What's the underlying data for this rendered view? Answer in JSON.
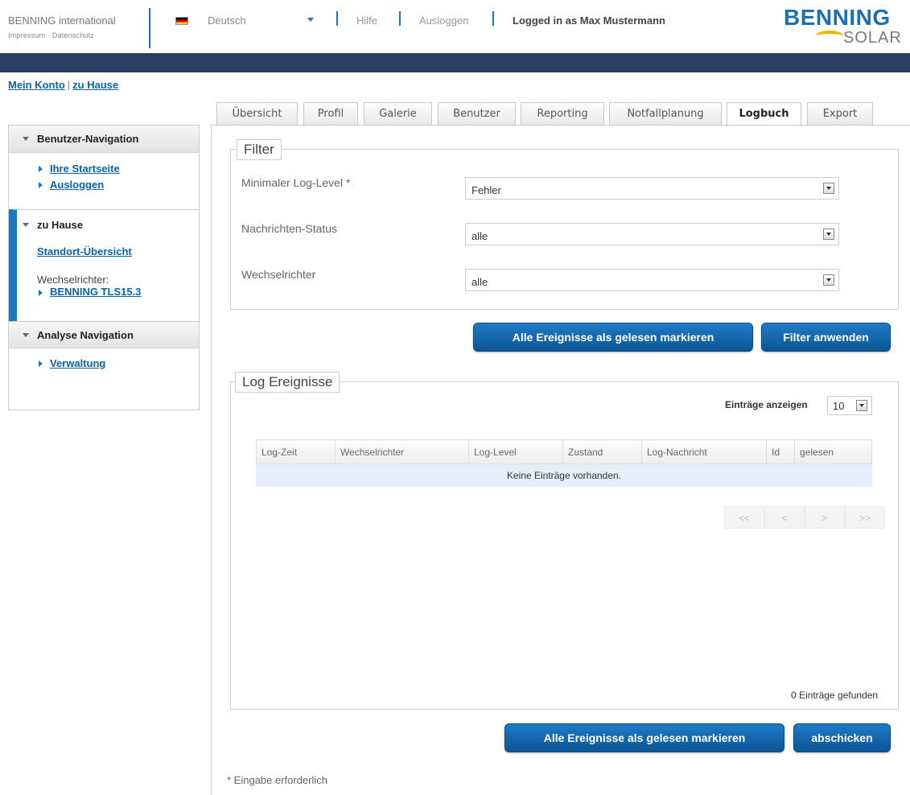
{
  "header": {
    "brand": "BENNING international",
    "brand_links": "Impressum · Datenschutz",
    "language": "Deutsch",
    "help": "Hilfe",
    "logout": "Ausloggen",
    "logged_in": "Logged in as Max Mustermann",
    "logo_line1": "BENNING",
    "logo_line2": "SOLAR"
  },
  "breadcrumb": {
    "item1": "Mein Konto",
    "sep": "|",
    "item2": "zu Hause"
  },
  "tabs": [
    "Übersicht",
    "Profil",
    "Galerie",
    "Benutzer",
    "Reporting",
    "Notfallplanung",
    "Logbuch",
    "Export"
  ],
  "sidebar": {
    "section1": {
      "title": "Benutzer-Navigation",
      "items": [
        "Ihre Startseite",
        "Ausloggen"
      ]
    },
    "section2": {
      "title": "zu Hause",
      "overview": "Standort-Übersicht",
      "inverter_label": "Wechselrichter:",
      "inverter": "BENNING TLS15.3"
    },
    "section3": {
      "title": "Analyse Navigation",
      "items": [
        "Verwaltung"
      ]
    }
  },
  "filter": {
    "legend": "Filter",
    "fields": [
      {
        "label": "Minimaler Log-Level *",
        "value": "Fehler"
      },
      {
        "label": "Nachrichten-Status",
        "value": "alle"
      },
      {
        "label": "Wechselrichter",
        "value": "alle"
      }
    ],
    "mark_read_button": "Alle Ereignisse als gelesen markieren",
    "apply_button": "Filter anwenden"
  },
  "log": {
    "legend": "Log Ereignisse",
    "entries_label": "Einträge anzeigen",
    "entries_value": "10",
    "columns": [
      "Log-Zeit",
      "Wechselrichter",
      "Log-Level",
      "Zustand",
      "Log-Nachricht",
      "Id",
      "gelesen"
    ],
    "empty_text": "Keine Einträge vorhanden.",
    "pager": [
      "<<",
      "<",
      ">",
      ">>"
    ],
    "found": "0 Einträge gefunden"
  },
  "bottom": {
    "mark_read_button": "Alle Ereignisse als gelesen markieren",
    "submit_button": "abschicken",
    "required_note": "* Eingabe erforderlich"
  },
  "colors": {
    "accent": "#1a78c2",
    "topbar": "#2a3e61",
    "button": "#0b5596"
  }
}
